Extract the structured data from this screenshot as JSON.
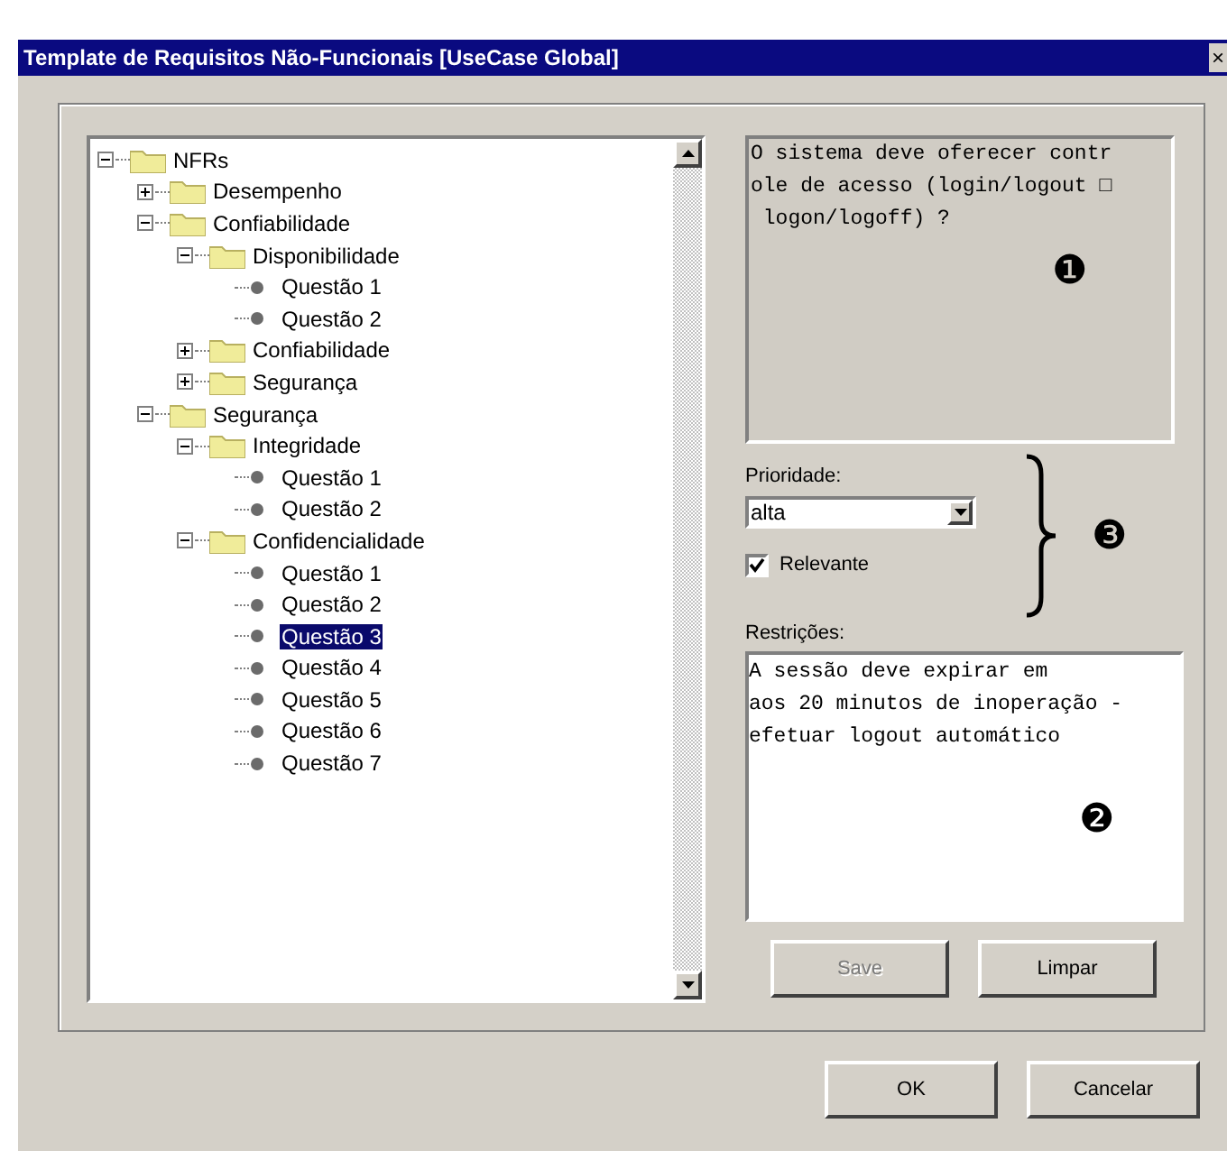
{
  "window": {
    "title": "Template de Requisitos Não-Funcionais [UseCase Global]",
    "close": "×"
  },
  "tree": [
    {
      "label": "NFRs",
      "kind": "folder",
      "expanded": true,
      "selected": false,
      "children": [
        {
          "label": "Desempenho",
          "kind": "folder",
          "expanded": false,
          "selected": false
        },
        {
          "label": "Confiabilidade",
          "kind": "folder",
          "expanded": true,
          "selected": false,
          "children": [
            {
              "label": "Disponibilidade",
              "kind": "folder",
              "expanded": true,
              "selected": false,
              "children": [
                {
                  "label": "Questão 1",
                  "kind": "leaf",
                  "selected": false
                },
                {
                  "label": "Questão 2",
                  "kind": "leaf",
                  "selected": false
                }
              ]
            },
            {
              "label": "Confiabilidade",
              "kind": "folder",
              "expanded": false,
              "selected": false
            },
            {
              "label": "Segurança",
              "kind": "folder",
              "expanded": false,
              "selected": false
            }
          ]
        },
        {
          "label": "Segurança",
          "kind": "folder",
          "expanded": true,
          "selected": false,
          "children": [
            {
              "label": "Integridade",
              "kind": "folder",
              "expanded": true,
              "selected": false,
              "children": [
                {
                  "label": "Questão 1",
                  "kind": "leaf",
                  "selected": false
                },
                {
                  "label": "Questão 2",
                  "kind": "leaf",
                  "selected": false
                }
              ]
            },
            {
              "label": "Confidencialidade",
              "kind": "folder",
              "expanded": true,
              "selected": false,
              "children": [
                {
                  "label": "Questão 1",
                  "kind": "leaf",
                  "selected": false
                },
                {
                  "label": "Questão 2",
                  "kind": "leaf",
                  "selected": false
                },
                {
                  "label": "Questão 3",
                  "kind": "leaf",
                  "selected": true
                },
                {
                  "label": "Questão 4",
                  "kind": "leaf",
                  "selected": false
                },
                {
                  "label": "Questão 5",
                  "kind": "leaf",
                  "selected": false
                },
                {
                  "label": "Questão 6",
                  "kind": "leaf",
                  "selected": false
                },
                {
                  "label": "Questão 7",
                  "kind": "leaf",
                  "selected": false
                }
              ]
            }
          ]
        }
      ]
    }
  ],
  "question": {
    "lines": [
      "O sistema deve oferecer contr",
      "ole de acesso (login/logout □",
      " logon/logoff) ?"
    ],
    "marker": "❶"
  },
  "priority": {
    "label": "Prioridade:",
    "value": "alta"
  },
  "relevant": {
    "label": "Relevante",
    "checked": true
  },
  "group_marker": "❸",
  "restrictions": {
    "label": "Restrições:",
    "lines": [
      "A sessão deve expirar em",
      "aos 20 minutos de inoperação -",
      "efetuar logout automático"
    ],
    "marker": "❷"
  },
  "buttons": [
    {
      "label": "Save",
      "disabled": true
    },
    {
      "label": "Limpar",
      "disabled": false
    }
  ],
  "dialog_buttons": [
    {
      "label": "OK",
      "disabled": false
    },
    {
      "label": "Cancelar",
      "disabled": false
    }
  ]
}
